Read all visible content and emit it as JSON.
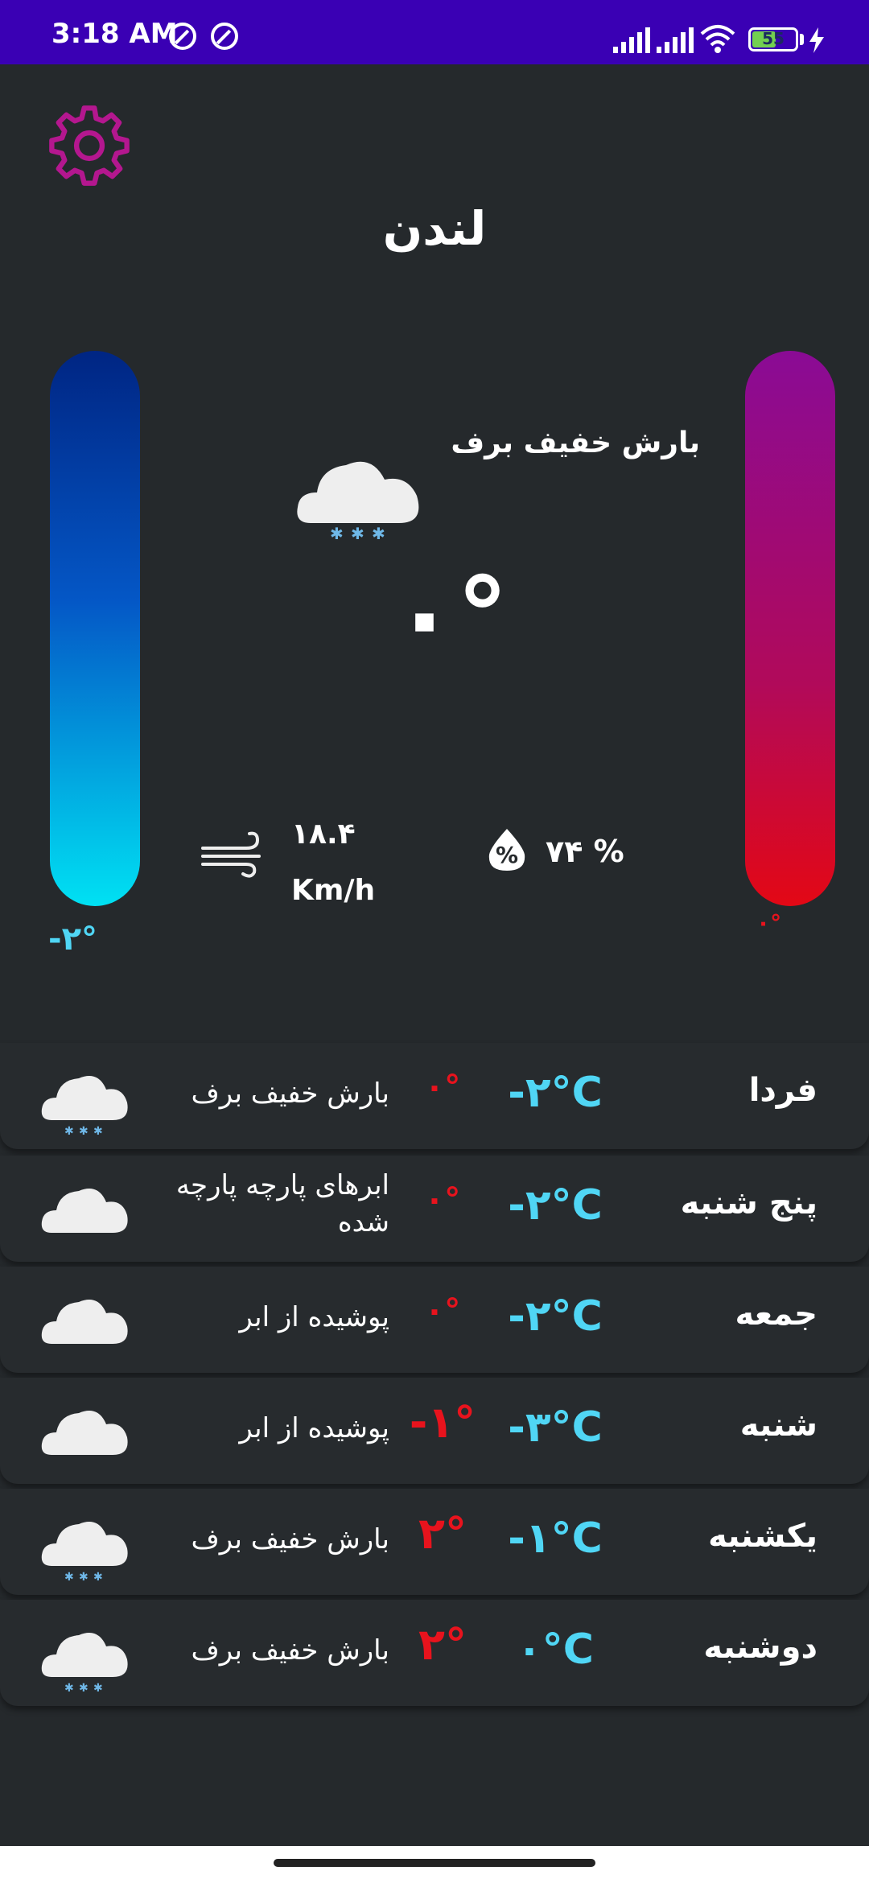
{
  "status_bar": {
    "time": "3:18 AM",
    "battery": "55",
    "battery_level": 0.55,
    "icons": [
      "data-saver-icon",
      "data-saver-icon",
      "signal-icon",
      "signal-icon",
      "wifi-icon",
      "battery-icon",
      "charging-icon"
    ]
  },
  "colors": {
    "status_bar": "#3a00b4",
    "background": "#25292c",
    "settings_icon": "#b4178f",
    "cold": "#50d6f5",
    "warm": "#e8131d"
  },
  "header": {
    "settings_icon": "gear-icon",
    "city": "لندن"
  },
  "current": {
    "condition": "بارش خفیف برف",
    "icon": "snow-cloud-icon",
    "temperature": "۰°",
    "min_temp": "-۲°",
    "max_temp": "۰°",
    "wind_value": "۱۸.۴",
    "wind_unit": "Km/h",
    "humidity": "۷۴ %"
  },
  "forecast": [
    {
      "day": "فردا",
      "low": "-۲°C",
      "high": "۰°",
      "desc": "بارش خفیف برف",
      "icon": "snow-cloud-icon"
    },
    {
      "day": "پنج شنبه",
      "low": "-۲°C",
      "high": "۰°",
      "desc": "ابرهای پارچه پارچه شده",
      "icon": "cloud-icon"
    },
    {
      "day": "جمعه",
      "low": "-۲°C",
      "high": "۰°",
      "desc": "پوشیده از ابر",
      "icon": "cloud-icon"
    },
    {
      "day": "شنبه",
      "low": "-۳°C",
      "high": "-۱°",
      "desc": "پوشیده از ابر",
      "icon": "cloud-icon"
    },
    {
      "day": "یکشنبه",
      "low": "-۱°C",
      "high": "۲°",
      "desc": "بارش خفیف برف",
      "icon": "snow-cloud-icon"
    },
    {
      "day": "دوشنبه",
      "low": "۰°C",
      "high": "۲°",
      "desc": "بارش خفیف برف",
      "icon": "snow-cloud-icon"
    }
  ]
}
